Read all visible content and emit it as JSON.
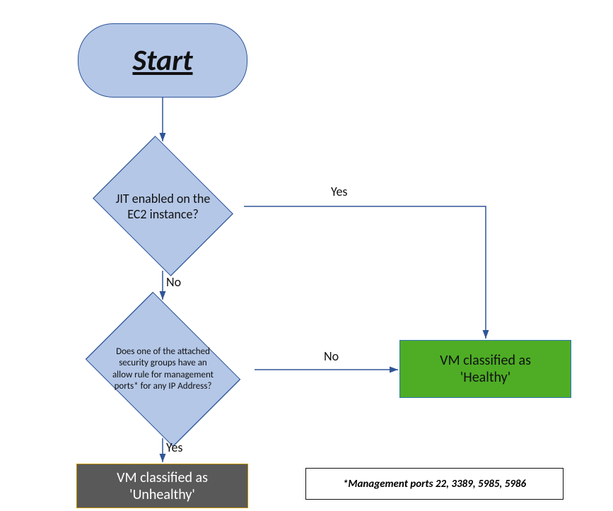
{
  "chart_data": {
    "type": "flowchart",
    "nodes": [
      {
        "id": "start",
        "type": "terminator",
        "label": "Start"
      },
      {
        "id": "d1",
        "type": "decision",
        "label": "JIT enabled on the EC2 instance?"
      },
      {
        "id": "d2",
        "type": "decision",
        "label": "Does one of the attached security groups have an allow rule for management ports* for any IP Address?"
      },
      {
        "id": "healthy",
        "type": "result",
        "label": "VM classified as 'Healthy'"
      },
      {
        "id": "unhealthy",
        "type": "result",
        "label": "VM classified as 'Unhealthy'"
      }
    ],
    "edges": [
      {
        "from": "start",
        "to": "d1",
        "label": ""
      },
      {
        "from": "d1",
        "to": "healthy",
        "label": "Yes"
      },
      {
        "from": "d1",
        "to": "d2",
        "label": "No"
      },
      {
        "from": "d2",
        "to": "healthy",
        "label": "No"
      },
      {
        "from": "d2",
        "to": "unhealthy",
        "label": "Yes"
      }
    ],
    "footnote": "*Management ports 22, 3389, 5985, 5986"
  },
  "start": {
    "label": "Start"
  },
  "d1": {
    "text": "JIT enabled on the EC2 instance?"
  },
  "d2": {
    "text": "Does one of the attached security groups have an allow rule for management ports* for any IP Address?"
  },
  "labels": {
    "yes1": "Yes",
    "no1": "No",
    "no2": "No",
    "yes2": "Yes"
  },
  "healthy": {
    "line1": "VM classified as",
    "line2": "'Healthy'"
  },
  "unhealthy": {
    "line1": "VM classified as",
    "line2": "'Unhealthy'"
  },
  "note": "*Management ports 22, 3389, 5985, 5986"
}
